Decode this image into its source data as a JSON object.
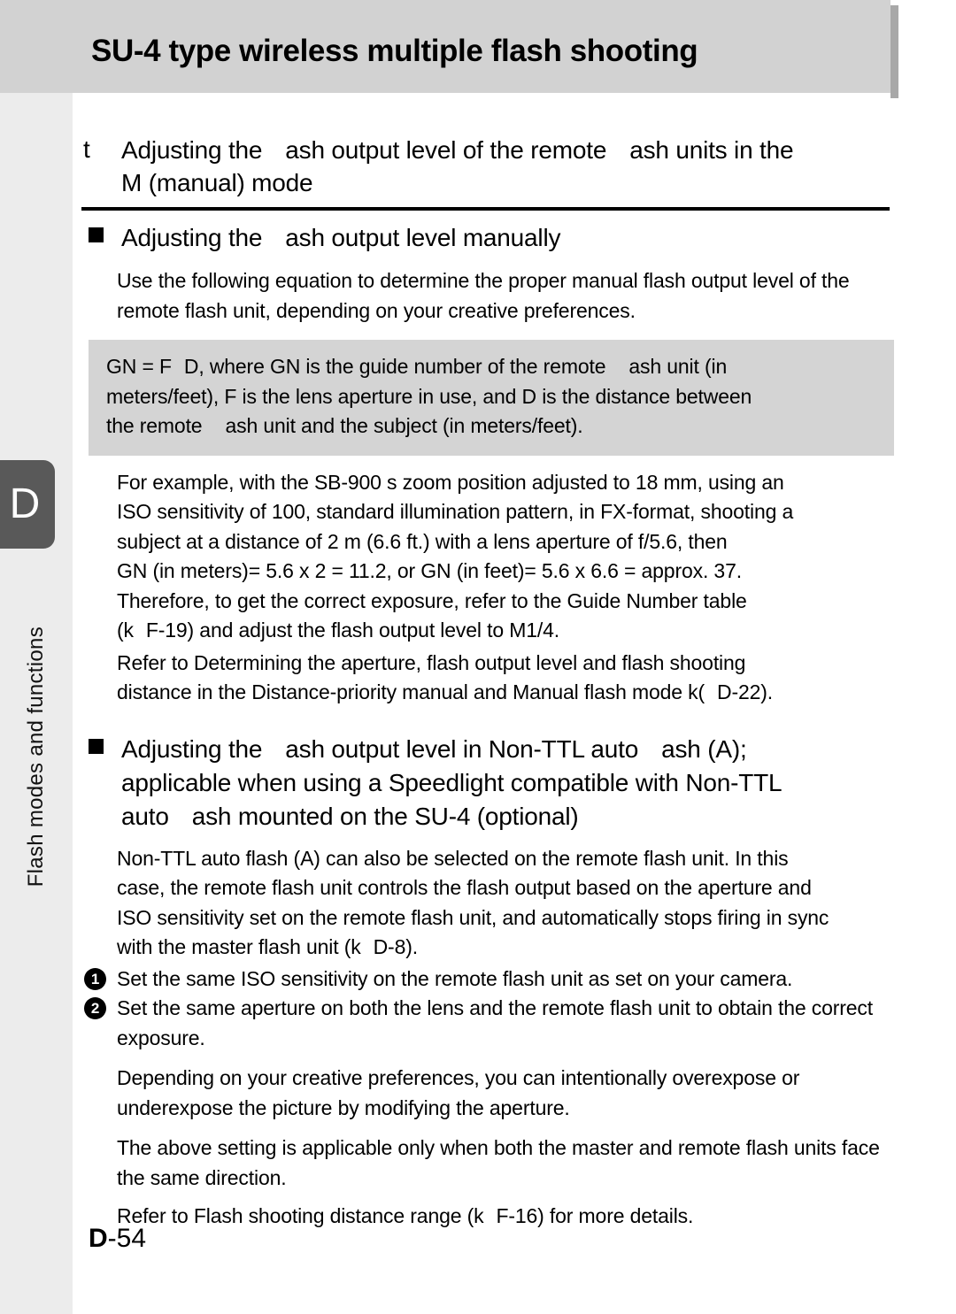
{
  "banner": {
    "title": "SU-4 type wireless multiple flash shooting"
  },
  "sidebar": {
    "chapter_letter": "D",
    "chapter_label": "Flash modes and functions",
    "tab_color": "#595959",
    "background_color": "#ececec"
  },
  "footer": {
    "letter": "D",
    "number": "-54"
  },
  "sections": [
    {
      "marker": "t",
      "heading_line_1_a": "Adjusting the",
      "heading_line_1_b": "ash output level of the remote",
      "heading_line_1_c": "ash units in the",
      "heading_line_2": "M (manual) mode"
    }
  ],
  "sub_heading_1": {
    "marker": "square-bullet",
    "text_a": "Adjusting the",
    "text_b": "ash output level manually"
  },
  "para_1": "Use the following equation to determine the proper manual flash output level of the remote flash unit, depending on your creative preferences.",
  "equation_box": {
    "line_1_a": "GN = F",
    "line_1_b": "D, where GN is the guide number of the remote",
    "line_1_c": "ash unit (in",
    "line_2": "meters/feet), F is the lens aperture in use, and D is the distance between",
    "line_3_a": "the remote",
    "line_3_b": "ash unit and the subject (in meters/feet)."
  },
  "example_para": {
    "line_1": "For example, with the SB-900 s zoom position adjusted to 18 mm, using an",
    "line_2": "ISO sensitivity of 100, standard illumination pattern, in FX-format,  shooting a",
    "line_3": "subject at a distance of 2 m (6.6 ft.) with a lens aperture of f/5.6, then",
    "line_4": "GN (in meters)= 5.6 x 2 = 11.2, or GN (in feet)= 5.6 x 6.6 = approx. 37.",
    "line_5": "Therefore, to get the correct exposure, refer to the Guide Number table",
    "line_6_a": "(k",
    "line_6_b": "F-19) and adjust the flash output level to M1/4."
  },
  "refer_para_1": {
    "line_1": "Refer to  Determining the aperture, flash output level and flash shooting",
    "line_2_a": "distance in the Distance-priority manual and Manual flash mode k(",
    "line_2_b": "D-22)."
  },
  "sub_heading_2": {
    "marker": "square-bullet",
    "line_1_a": "Adjusting the",
    "line_1_b": "ash output level in Non-TTL auto",
    "line_1_c": "ash (A);",
    "line_2": "applicable when using a Speedlight compatible with Non-TTL",
    "line_3_a": "auto",
    "line_3_b": "ash mounted on the SU-4 (optional)"
  },
  "para_2": {
    "line_1": "Non-TTL auto flash (A) can also be selected on the remote flash unit. In this",
    "line_2": "case, the remote flash unit controls the flash output based on the aperture and",
    "line_3": "ISO sensitivity set on the remote flash unit, and automatically stops firing in sync",
    "line_4_a": "with the master flash unit (k",
    "line_4_b": "D-8)."
  },
  "numbered_items": [
    {
      "number": "1",
      "text": "Set the same ISO sensitivity on the remote flash unit as set on your camera."
    },
    {
      "number": "2",
      "text": "Set the same aperture on both the lens and the remote flash unit to obtain the correct exposure."
    }
  ],
  "para_3": "Depending on your creative preferences, you can intentionally overexpose or underexpose the picture by modifying the aperture.",
  "para_4": "The above setting is applicable only when both the master and remote flash units face the same direction.",
  "refer_para_2": {
    "line_a": "Refer to  Flash shooting distance range  (k",
    "line_b": "F-16) for more details."
  }
}
